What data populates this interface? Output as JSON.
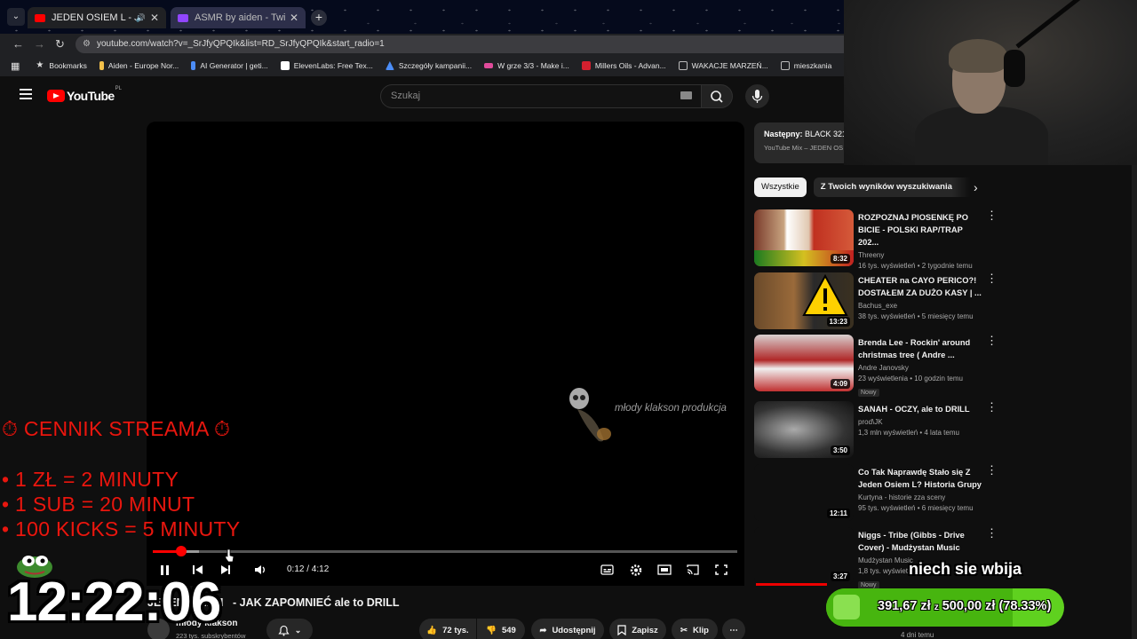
{
  "browser": {
    "tabs": [
      {
        "title": "JEDEN OSIEM L - JAK ZAPO",
        "active": true
      },
      {
        "title": "ASMR by aiden - Twitch",
        "active": false
      }
    ],
    "new_tab": "+",
    "url": "youtube.com/watch?v=_SrJfyQPQIk&list=RD_SrJfyQPQIk&start_radio=1",
    "bookmarks": [
      {
        "label": "Bookmarks",
        "color": "#dddddd"
      },
      {
        "label": "Aiden - Europe Nor...",
        "color": "#f3c04a"
      },
      {
        "label": "AI Generator | geti...",
        "color": "#4c8cf5"
      },
      {
        "label": "ElevenLabs: Free Tex...",
        "color": "#ffffff"
      },
      {
        "label": "Szczegóły kampanii...",
        "color": "#4b8df8"
      },
      {
        "label": "W grze 3/3 - Make i...",
        "color": "#e04b9b"
      },
      {
        "label": "Millers Oils - Advan...",
        "color": "#d3202f"
      },
      {
        "label": "WAKACJE MARZEŃ...",
        "color": "#bbbbbb"
      },
      {
        "label": "mieszkania",
        "color": "#bbbbbb"
      }
    ]
  },
  "youtube": {
    "logo_text": "YouTube",
    "logo_country": "PL",
    "search_placeholder": "Szukaj",
    "player": {
      "watermark": "młody klakson produkcja",
      "time": "0:12 / 4:12",
      "progress_fraction": 0.048,
      "buffered_fraction": 0.079
    },
    "video_title_prefix": "JEDEN OSIEM",
    "video_title": "- JAK ZAPOMNIEĆ ale to DRILL",
    "channel": "młody klakson",
    "subscribers": "223 tys. subskrybentów",
    "actions": {
      "likes": "72 tys.",
      "dislikes": "549",
      "share": "Udostępnij",
      "save": "Zapisz",
      "clip": "Klip"
    },
    "up_next": {
      "label": "Następny:",
      "title": "BLACK 321",
      "sub": "YouTube Mix – JEDEN OS"
    },
    "chips": [
      "Wszystkie",
      "Z Twoich wyników wyszukiwania"
    ],
    "videos": [
      {
        "title": "ROZPOZNAJ PIOSENKĘ PO BICIE - POLSKI RAP/TRAP 202...",
        "channel": "Threeny",
        "stats": "16 tys. wyświetleń • 2 tygodnie temu",
        "duration": "8:32",
        "badge": ""
      },
      {
        "title": "CHEATER na CAYO PERICO?! DOSTAŁEM ZA DUŻO KASY | ...",
        "channel": "Bachus_exe",
        "stats": "38 tys. wyświetleń • 5 miesięcy temu",
        "duration": "13:23",
        "badge": ""
      },
      {
        "title": "Brenda Lee - Rockin' around christmas tree ( Andre ...",
        "channel": "Andre Janovsky",
        "stats": "23 wyświetlenia • 10 godzin temu",
        "duration": "4:09",
        "badge": "Nowy"
      },
      {
        "title": "SANAH - OCZY, ale to DRILL",
        "channel": "prod\\JK",
        "stats": "1,3 mln wyświetleń • 4 lata temu",
        "duration": "3:50",
        "badge": ""
      },
      {
        "title": "Co Tak Naprawdę Stało się Z Jeden Osiem L? Historia Grupy",
        "channel": "Kurtyna - historie zza sceny",
        "stats": "95 tys. wyświetleń • 6 miesięcy temu",
        "duration": "12:11",
        "badge": ""
      },
      {
        "title": "Niggs - Tribe (Gibbs - Drive Cover) - Mudżystan Music",
        "channel": "Mudżystan Music",
        "stats": "1,8 tys. wyświetleń",
        "duration": "3:27",
        "badge": "Nowy"
      }
    ],
    "last_stats": "4 dni temu"
  },
  "overlay": {
    "price_title": "⏱ CENNIK STREAMA ⏱",
    "price_lines": [
      "• 1 ZŁ = 2 MINUTY",
      "• 1 SUB = 20 MINUT",
      "• 100 KICKS = 5 MINUTY"
    ],
    "clock": "12:22:06",
    "chat_text": "niech sie wbija",
    "goal_current": "391,67 zł",
    "goal_sep": "z",
    "goal_target": "500,00 zł",
    "goal_percent": "(78.33%)",
    "goal_fraction": 0.7833
  },
  "colors": {
    "accent": "#ff0000",
    "overlay_red": "#e8170f",
    "goal_green": "#5fd11f"
  }
}
